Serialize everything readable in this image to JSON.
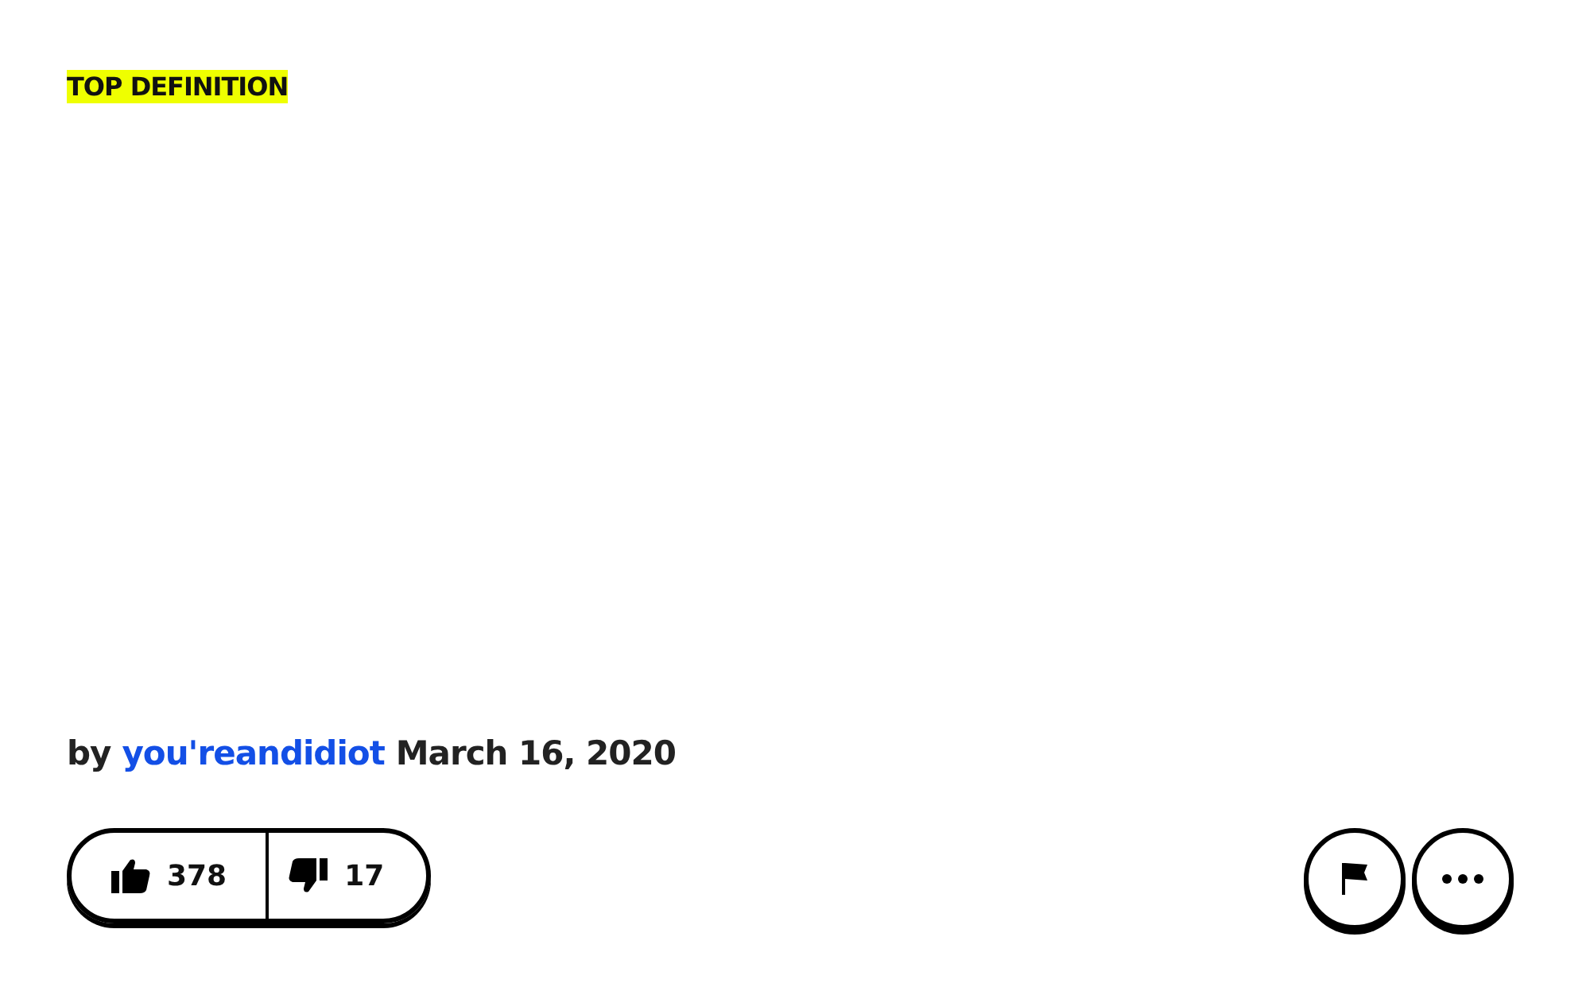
{
  "badge": "TOP DEFINITION",
  "byline": {
    "prefix": "by",
    "author": "you'reandidiot",
    "date": "March 16, 2020"
  },
  "votes": {
    "up": "378",
    "down": "17"
  }
}
